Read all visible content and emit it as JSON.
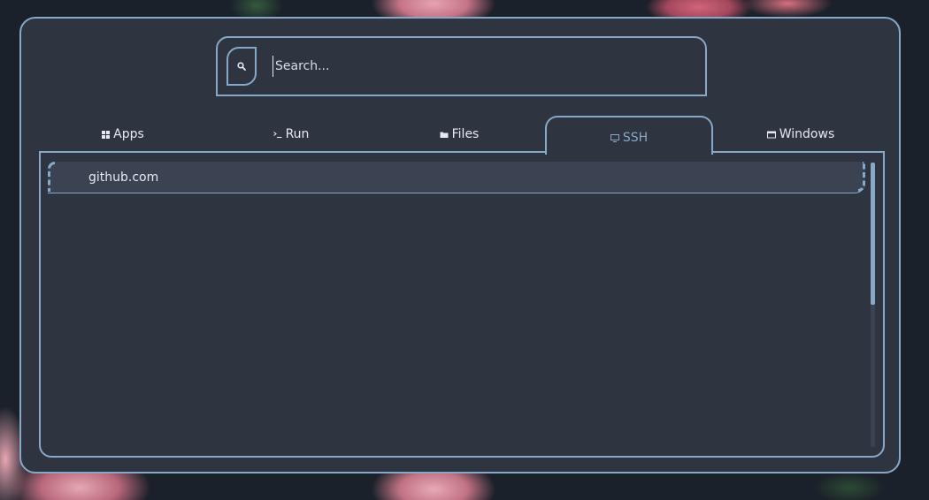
{
  "search": {
    "placeholder": "Search..."
  },
  "tabs": [
    {
      "label": "Apps",
      "icon": "grid-icon",
      "active": false
    },
    {
      "label": "Run",
      "icon": "terminal-icon",
      "active": false
    },
    {
      "label": "Files",
      "icon": "folder-icon",
      "active": false
    },
    {
      "label": "SSH",
      "icon": "monitor-icon",
      "active": true
    },
    {
      "label": "Windows",
      "icon": "window-icon",
      "active": false
    }
  ],
  "results": {
    "items": [
      {
        "label": "github.com",
        "selected": true
      }
    ],
    "scroll_fraction_visible": 0.5
  },
  "colors": {
    "background": "#2e3440",
    "accent": "#88a8c8",
    "selected_row": "#3b4252",
    "text": "#e5e9f0"
  }
}
